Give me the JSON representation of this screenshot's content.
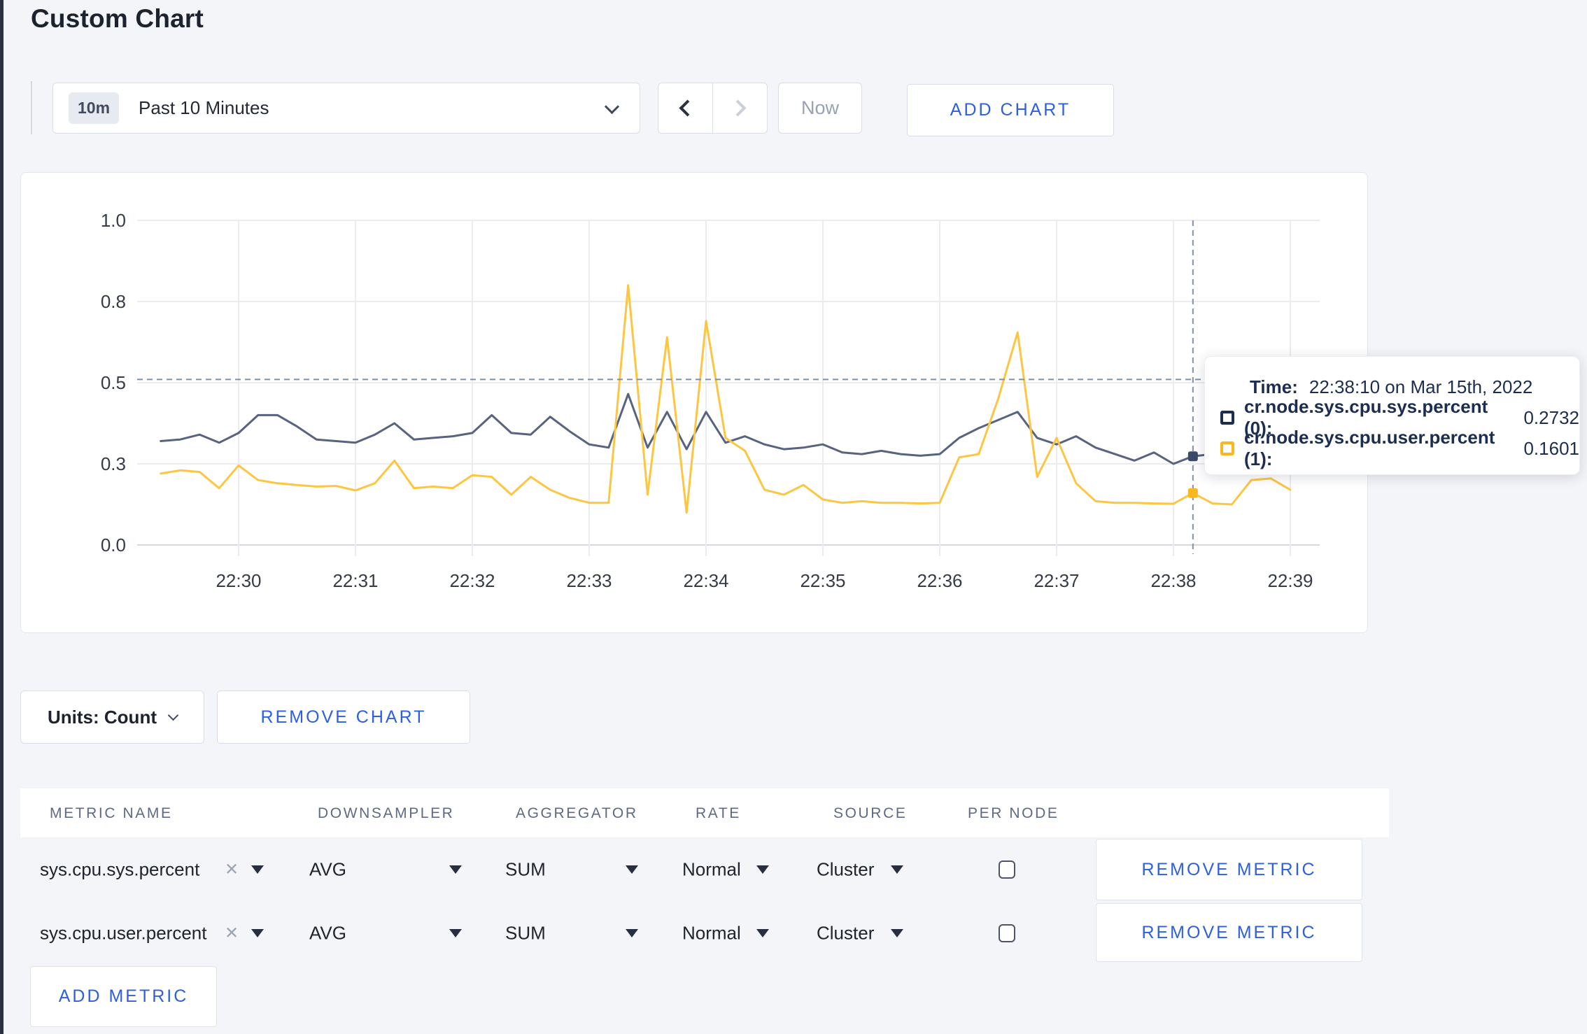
{
  "page": {
    "title": "Custom Chart",
    "accent_blue": "#2d5fe0",
    "background": "#f4f5f8"
  },
  "toolbar": {
    "time_badge": "10m",
    "time_range_label": "Past 10 Minutes",
    "now_label": "Now",
    "add_chart_label": "ADD CHART"
  },
  "chart": {
    "tooltip": {
      "time_label": "Time:",
      "time_value": "22:38:10 on Mar 15th, 2022",
      "series": [
        {
          "name": "cr.node.sys.cpu.sys.percent (0):",
          "value": "0.2732",
          "color": "#1c2e50"
        },
        {
          "name": "cr.node.sys.cpu.user.percent (1):",
          "value": "0.1601",
          "color": "#fdb71e"
        }
      ]
    }
  },
  "chart_data": {
    "type": "line",
    "title": "",
    "xlabel": "",
    "ylabel": "",
    "ylim": [
      0,
      1
    ],
    "grid": true,
    "legend_position": "tooltip",
    "y_tick_values": [
      1,
      0.75,
      0.5,
      0.25,
      0
    ],
    "y_tick_labels": [
      "1.0",
      "0.8",
      "0.5",
      "0.3",
      "0.0"
    ],
    "x_ticks": [
      "22:30",
      "22:31",
      "22:32",
      "22:33",
      "22:34",
      "22:35",
      "22:36",
      "22:37",
      "22:38",
      "22:39"
    ],
    "x_start_time": "22:29:20",
    "interval_seconds": 10,
    "x_times": [
      "22:29:20",
      "22:29:30",
      "22:29:40",
      "22:29:50",
      "22:30:00",
      "22:30:10",
      "22:30:20",
      "22:30:30",
      "22:30:40",
      "22:30:50",
      "22:31:00",
      "22:31:10",
      "22:31:20",
      "22:31:30",
      "22:31:40",
      "22:31:50",
      "22:32:00",
      "22:32:10",
      "22:32:20",
      "22:32:30",
      "22:32:40",
      "22:32:50",
      "22:33:00",
      "22:33:10",
      "22:33:20",
      "22:33:30",
      "22:33:40",
      "22:33:50",
      "22:34:00",
      "22:34:10",
      "22:34:20",
      "22:34:30",
      "22:34:40",
      "22:34:50",
      "22:35:00",
      "22:35:10",
      "22:35:20",
      "22:35:30",
      "22:35:40",
      "22:35:50",
      "22:36:00",
      "22:36:10",
      "22:36:20",
      "22:36:30",
      "22:36:40",
      "22:36:50",
      "22:37:00",
      "22:37:10",
      "22:37:20",
      "22:37:30",
      "22:37:40",
      "22:37:50",
      "22:38:00",
      "22:38:10",
      "22:38:20",
      "22:38:30",
      "22:38:40",
      "22:38:50",
      "22:39:00"
    ],
    "series": [
      {
        "name": "cr.node.sys.cpu.sys.percent",
        "color": "#57637f",
        "marker_color": "#3c4a68",
        "values": [
          0.32,
          0.325,
          0.34,
          0.315,
          0.345,
          0.4,
          0.4,
          0.365,
          0.325,
          0.32,
          0.315,
          0.34,
          0.375,
          0.325,
          0.33,
          0.335,
          0.345,
          0.4,
          0.345,
          0.34,
          0.395,
          0.35,
          0.31,
          0.3,
          0.465,
          0.3,
          0.41,
          0.295,
          0.41,
          0.315,
          0.335,
          0.31,
          0.295,
          0.3,
          0.31,
          0.285,
          0.28,
          0.29,
          0.28,
          0.275,
          0.28,
          0.33,
          0.36,
          0.385,
          0.41,
          0.33,
          0.31,
          0.335,
          0.3,
          0.28,
          0.26,
          0.285,
          0.25,
          0.2732,
          0.28,
          0.285,
          0.3,
          0.27,
          0.295
        ]
      },
      {
        "name": "cr.node.sys.cpu.user.percent",
        "color": "#fdc642",
        "marker_color": "#fdb71e",
        "values": [
          0.22,
          0.23,
          0.225,
          0.175,
          0.245,
          0.2,
          0.19,
          0.185,
          0.18,
          0.182,
          0.168,
          0.19,
          0.26,
          0.175,
          0.18,
          0.175,
          0.215,
          0.21,
          0.155,
          0.21,
          0.17,
          0.145,
          0.13,
          0.13,
          0.8,
          0.155,
          0.64,
          0.1,
          0.69,
          0.33,
          0.29,
          0.17,
          0.155,
          0.185,
          0.14,
          0.13,
          0.135,
          0.13,
          0.13,
          0.128,
          0.13,
          0.27,
          0.28,
          0.45,
          0.655,
          0.21,
          0.33,
          0.19,
          0.135,
          0.13,
          0.13,
          0.128,
          0.127,
          0.1601,
          0.128,
          0.125,
          0.2,
          0.205,
          0.17
        ]
      }
    ],
    "crosshair": {
      "time": "22:38:10",
      "values": [
        0.2732,
        0.1601
      ],
      "hline_value": 0.51
    }
  },
  "units_row": {
    "units_label": "Units: Count",
    "remove_chart_label": "REMOVE CHART"
  },
  "metrics_table": {
    "headers": [
      "METRIC NAME",
      "DOWNSAMPLER",
      "AGGREGATOR",
      "RATE",
      "SOURCE",
      "PER NODE"
    ],
    "rows": [
      {
        "metric": "sys.cpu.sys.percent",
        "downsampler": "AVG",
        "aggregator": "SUM",
        "rate": "Normal",
        "source": "Cluster",
        "per_node_checked": false,
        "remove_label": "REMOVE METRIC"
      },
      {
        "metric": "sys.cpu.user.percent",
        "downsampler": "AVG",
        "aggregator": "SUM",
        "rate": "Normal",
        "source": "Cluster",
        "per_node_checked": false,
        "remove_label": "REMOVE METRIC"
      }
    ],
    "add_metric_label": "ADD METRIC",
    "close_icon": "✕"
  }
}
